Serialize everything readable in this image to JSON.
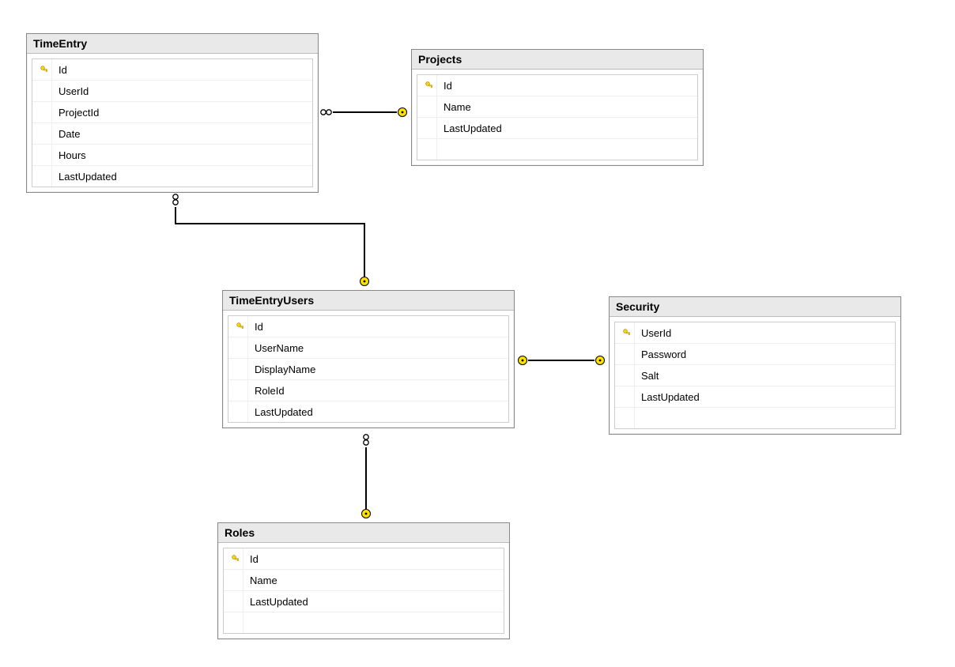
{
  "entities": {
    "timeEntry": {
      "title": "TimeEntry",
      "columns": [
        "Id",
        "UserId",
        "ProjectId",
        "Date",
        "Hours",
        "LastUpdated"
      ],
      "pk": [
        true,
        false,
        false,
        false,
        false,
        false
      ]
    },
    "projects": {
      "title": "Projects",
      "columns": [
        "Id",
        "Name",
        "LastUpdated"
      ],
      "pk": [
        true,
        false,
        false
      ]
    },
    "timeEntryUsers": {
      "title": "TimeEntryUsers",
      "columns": [
        "Id",
        "UserName",
        "DisplayName",
        "RoleId",
        "LastUpdated"
      ],
      "pk": [
        true,
        false,
        false,
        false,
        false
      ]
    },
    "security": {
      "title": "Security",
      "columns": [
        "UserId",
        "Password",
        "Salt",
        "LastUpdated"
      ],
      "pk": [
        true,
        false,
        false,
        false
      ]
    },
    "roles": {
      "title": "Roles",
      "columns": [
        "Id",
        "Name",
        "LastUpdated"
      ],
      "pk": [
        true,
        false,
        false
      ]
    }
  },
  "relationships": [
    {
      "from": "TimeEntry",
      "fromCardinality": "many",
      "to": "Projects",
      "toCardinality": "one"
    },
    {
      "from": "TimeEntry",
      "fromCardinality": "many",
      "to": "TimeEntryUsers",
      "toCardinality": "one"
    },
    {
      "from": "TimeEntryUsers",
      "fromCardinality": "one",
      "to": "Security",
      "toCardinality": "one"
    },
    {
      "from": "TimeEntryUsers",
      "fromCardinality": "many",
      "to": "Roles",
      "toCardinality": "one"
    }
  ]
}
